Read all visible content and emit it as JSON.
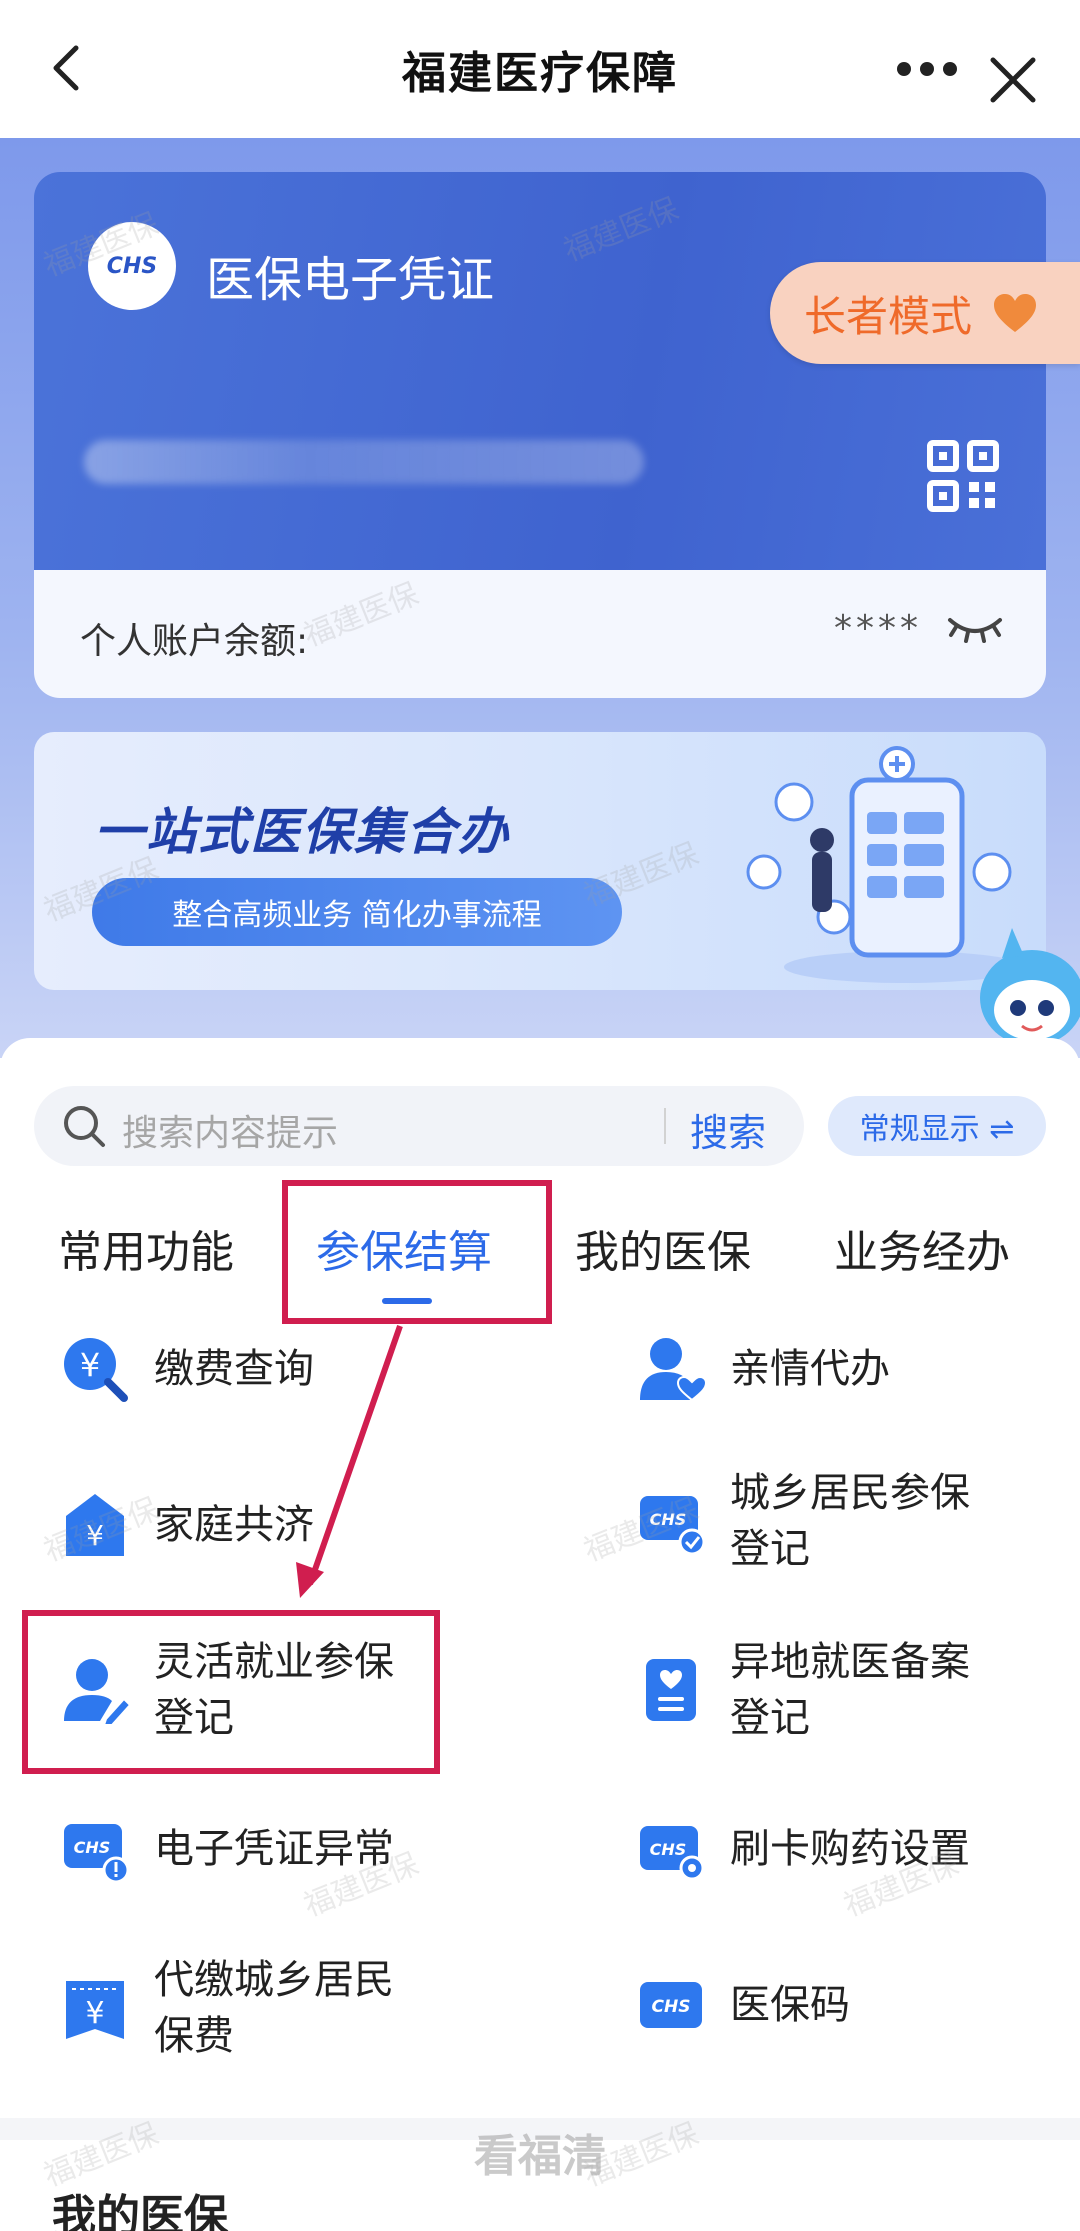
{
  "topbar": {
    "title": "福建医疗保障"
  },
  "card": {
    "logo_text": "CHS",
    "title": "医保电子凭证"
  },
  "elder_mode": {
    "label": "长者模式"
  },
  "balance": {
    "label": "个人账户余额:",
    "value": "****"
  },
  "banner": {
    "headline": "一站式医保集合办",
    "subtitle": "整合高频业务 简化办事流程"
  },
  "search": {
    "placeholder": "搜索内容提示",
    "button": "搜索"
  },
  "display_mode": {
    "label": "常规显示 ⇌"
  },
  "tabs": [
    {
      "label": "常用功能"
    },
    {
      "label": "参保结算"
    },
    {
      "label": "我的医保"
    },
    {
      "label": "业务经办"
    }
  ],
  "active_tab": "参保结算",
  "items": [
    {
      "label": "缴费查询",
      "icon": "payment-search-icon"
    },
    {
      "label": "亲情代办",
      "icon": "family-proxy-icon"
    },
    {
      "label": "家庭共济",
      "icon": "family-mutual-aid-icon"
    },
    {
      "label": "城乡居民参保登记",
      "icon": "resident-insurance-register-icon"
    },
    {
      "label": "灵活就业参保登记",
      "icon": "flexible-employment-register-icon"
    },
    {
      "label": "异地就医备案登记",
      "icon": "remote-medical-filing-icon"
    },
    {
      "label": "电子凭证异常",
      "icon": "e-voucher-abnormal-icon"
    },
    {
      "label": "刷卡购药设置",
      "icon": "card-medicine-settings-icon"
    },
    {
      "label": "代缴城乡居民保费",
      "icon": "proxy-pay-premium-icon"
    },
    {
      "label": "医保码",
      "icon": "insurance-code-icon"
    }
  ],
  "section": {
    "title": "我的医保"
  },
  "watermarks": {
    "text": "福建医保",
    "bottom": "看福清"
  },
  "colors": {
    "accent": "#2c6ae8",
    "card_blue": "#4169d6",
    "highlight": "#d01e4f",
    "elder_text": "#ef6a2a"
  }
}
